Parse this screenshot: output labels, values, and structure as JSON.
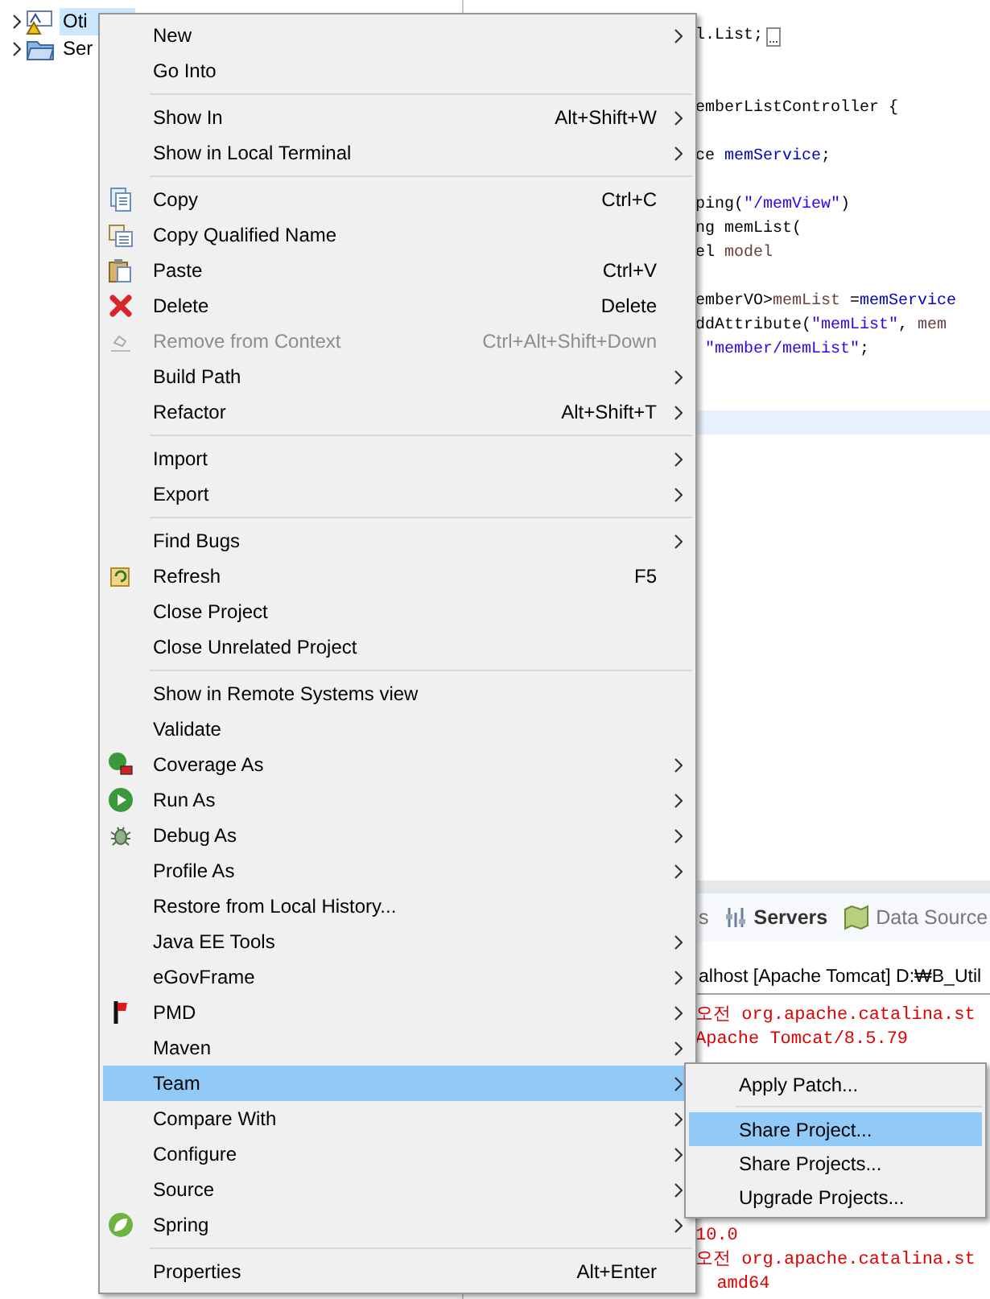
{
  "explorer": {
    "items": [
      {
        "label": "Oti",
        "selected": true
      },
      {
        "label": "Ser",
        "selected": false
      }
    ]
  },
  "editor": {
    "lines": [
      {
        "current": false
      },
      {
        "segments": [
          {
            "text": "l.List;",
            "kind": "plain"
          }
        ],
        "folded": true,
        "current": false
      },
      {
        "current": false
      },
      {
        "current": false
      },
      {
        "segments": [
          {
            "text": "emberListController {",
            "kind": "plain"
          }
        ],
        "current": false
      },
      {
        "current": false
      },
      {
        "segments": [
          {
            "text": "ce ",
            "kind": "plain"
          },
          {
            "text": "memService",
            "kind": "field"
          },
          {
            "text": ";",
            "kind": "plain"
          }
        ],
        "current": false
      },
      {
        "current": false
      },
      {
        "segments": [
          {
            "text": "ping(",
            "kind": "plain"
          },
          {
            "text": "\"/memView\"",
            "kind": "string"
          },
          {
            "text": ")",
            "kind": "plain"
          }
        ],
        "current": false
      },
      {
        "segments": [
          {
            "text": "ng memList(",
            "kind": "plain"
          }
        ],
        "current": false
      },
      {
        "segments": [
          {
            "text": "el ",
            "kind": "plain"
          },
          {
            "text": "model",
            "kind": "var"
          }
        ],
        "current": false
      },
      {
        "current": false
      },
      {
        "segments": [
          {
            "text": "emberVO>",
            "kind": "plain"
          },
          {
            "text": "memList",
            "kind": "var"
          },
          {
            "text": " =",
            "kind": "plain"
          },
          {
            "text": "memService",
            "kind": "field"
          }
        ],
        "current": false
      },
      {
        "segments": [
          {
            "text": "ddAttribute(",
            "kind": "plain"
          },
          {
            "text": "\"memList\"",
            "kind": "string"
          },
          {
            "text": ", ",
            "kind": "plain"
          },
          {
            "text": "mem",
            "kind": "var"
          }
        ],
        "current": false
      },
      {
        "segments": [
          {
            "text": "\"member/memList\"",
            "kind": "string"
          },
          {
            "text": ";",
            "kind": "plain"
          }
        ],
        "current": false
      },
      {
        "current": false
      },
      {
        "current": false
      },
      {
        "current": true
      }
    ]
  },
  "panel": {
    "tabs": [
      {
        "label": "s",
        "selected": false
      },
      {
        "label": "Servers",
        "selected": true
      },
      {
        "label": "Data Source",
        "selected": false
      }
    ],
    "console_header": "alhost [Apache Tomcat] D:₩B_Util",
    "blocks": [
      [
        "오전 org.apache.catalina.st",
        "Apache Tomcat/8.5.79"
      ],
      [
        "10.0",
        "오전 org.apache.catalina.st",
        "  amd64"
      ]
    ]
  },
  "context_menu": {
    "groups": [
      [
        {
          "label": "New",
          "has_submenu": true,
          "disabled": false,
          "selected": false
        },
        {
          "label": "Go Into",
          "has_submenu": false,
          "disabled": false,
          "selected": false
        }
      ],
      [
        {
          "label": "Show In",
          "shortcut": "Alt+Shift+W",
          "has_submenu": true,
          "disabled": false,
          "selected": false
        },
        {
          "label": "Show in Local Terminal",
          "has_submenu": true,
          "disabled": false,
          "selected": false
        }
      ],
      [
        {
          "label": "Copy",
          "shortcut": "Ctrl+C",
          "has_submenu": false,
          "disabled": false,
          "selected": false
        },
        {
          "label": "Copy Qualified Name",
          "has_submenu": false,
          "disabled": false,
          "selected": false
        },
        {
          "label": "Paste",
          "shortcut": "Ctrl+V",
          "has_submenu": false,
          "disabled": false,
          "selected": false
        },
        {
          "label": "Delete",
          "shortcut": "Delete",
          "has_submenu": false,
          "disabled": false,
          "selected": false
        },
        {
          "label": "Remove from Context",
          "shortcut": "Ctrl+Alt+Shift+Down",
          "has_submenu": false,
          "disabled": true,
          "selected": false
        },
        {
          "label": "Build Path",
          "has_submenu": true,
          "disabled": false,
          "selected": false
        },
        {
          "label": "Refactor",
          "shortcut": "Alt+Shift+T",
          "has_submenu": true,
          "disabled": false,
          "selected": false
        }
      ],
      [
        {
          "label": "Import",
          "has_submenu": true,
          "disabled": false,
          "selected": false
        },
        {
          "label": "Export",
          "has_submenu": true,
          "disabled": false,
          "selected": false
        }
      ],
      [
        {
          "label": "Find Bugs",
          "has_submenu": true,
          "disabled": false,
          "selected": false
        },
        {
          "label": "Refresh",
          "shortcut": "F5",
          "has_submenu": false,
          "disabled": false,
          "selected": false
        },
        {
          "label": "Close Project",
          "has_submenu": false,
          "disabled": false,
          "selected": false
        },
        {
          "label": "Close Unrelated Project",
          "has_submenu": false,
          "disabled": false,
          "selected": false
        }
      ],
      [
        {
          "label": "Show in Remote Systems view",
          "has_submenu": false,
          "disabled": false,
          "selected": false
        },
        {
          "label": "Validate",
          "has_submenu": false,
          "disabled": false,
          "selected": false
        },
        {
          "label": "Coverage As",
          "has_submenu": true,
          "disabled": false,
          "selected": false
        },
        {
          "label": "Run As",
          "has_submenu": true,
          "disabled": false,
          "selected": false
        },
        {
          "label": "Debug As",
          "has_submenu": true,
          "disabled": false,
          "selected": false
        },
        {
          "label": "Profile As",
          "has_submenu": true,
          "disabled": false,
          "selected": false
        },
        {
          "label": "Restore from Local History...",
          "has_submenu": false,
          "disabled": false,
          "selected": false
        },
        {
          "label": "Java EE Tools",
          "has_submenu": true,
          "disabled": false,
          "selected": false
        },
        {
          "label": "eGovFrame",
          "has_submenu": true,
          "disabled": false,
          "selected": false
        },
        {
          "label": "PMD",
          "has_submenu": true,
          "disabled": false,
          "selected": false
        },
        {
          "label": "Maven",
          "has_submenu": true,
          "disabled": false,
          "selected": false
        },
        {
          "label": "Team",
          "has_submenu": true,
          "disabled": false,
          "selected": true
        },
        {
          "label": "Compare With",
          "has_submenu": true,
          "disabled": false,
          "selected": false
        },
        {
          "label": "Configure",
          "has_submenu": true,
          "disabled": false,
          "selected": false
        },
        {
          "label": "Source",
          "has_submenu": true,
          "disabled": false,
          "selected": false
        },
        {
          "label": "Spring",
          "has_submenu": true,
          "disabled": false,
          "selected": false
        }
      ],
      [
        {
          "label": "Properties",
          "shortcut": "Alt+Enter",
          "has_submenu": false,
          "disabled": false,
          "selected": false
        }
      ]
    ]
  },
  "team_submenu": {
    "groups": [
      [
        {
          "label": "Apply Patch...",
          "selected": false
        }
      ],
      [
        {
          "label": "Share Project...",
          "selected": true
        },
        {
          "label": "Share Projects...",
          "selected": false
        },
        {
          "label": "Upgrade Projects...",
          "selected": false
        }
      ]
    ]
  }
}
